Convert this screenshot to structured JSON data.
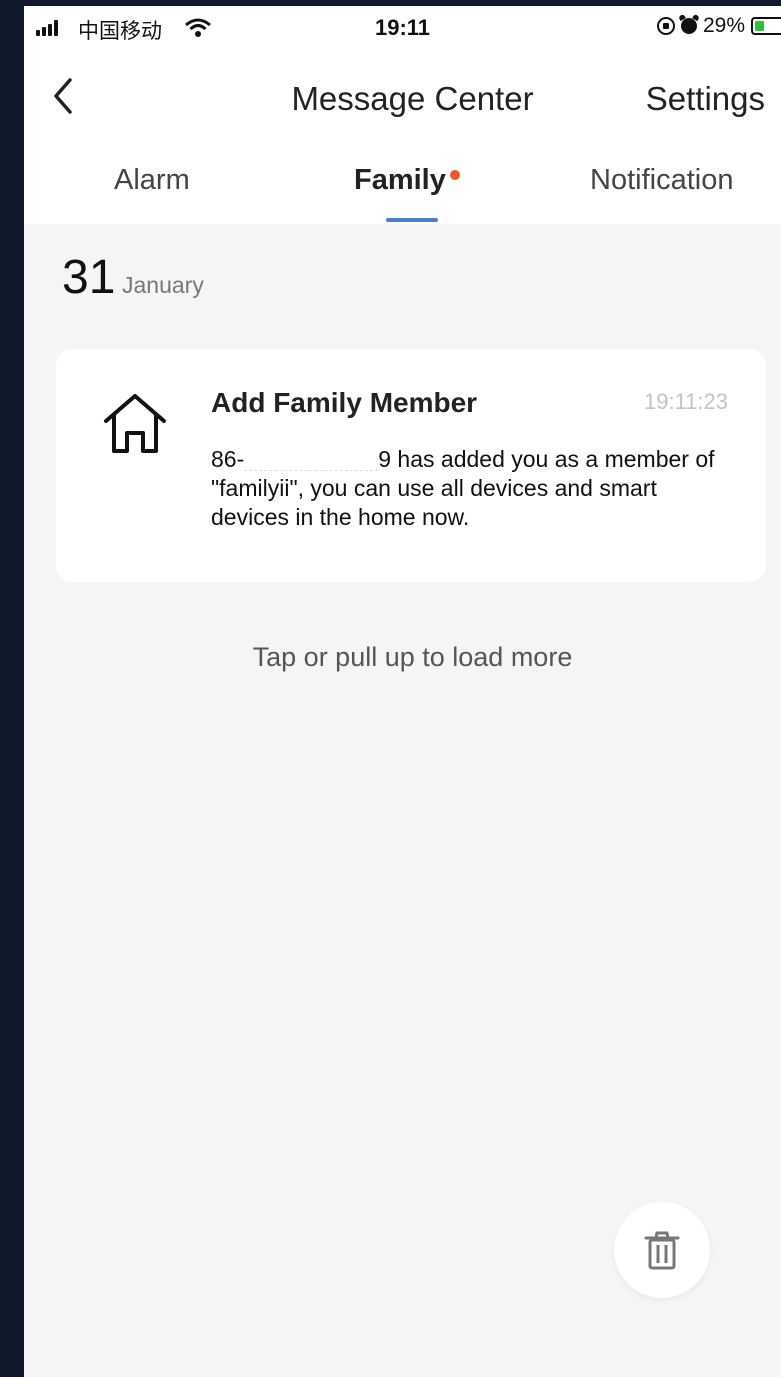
{
  "status_bar": {
    "carrier": "中国移动",
    "time": "19:11",
    "battery": "29%"
  },
  "nav": {
    "back_icon": "chevron-left-icon",
    "title": "Message Center",
    "settings_label": "Settings"
  },
  "tabs": [
    {
      "label": "Alarm",
      "active": false,
      "unread": false
    },
    {
      "label": "Family",
      "active": true,
      "unread": true
    },
    {
      "label": "Notification",
      "active": false,
      "unread": false
    }
  ],
  "date": {
    "day": "31",
    "month": "January"
  },
  "messages": [
    {
      "icon": "home-icon",
      "title": "Add Family Member",
      "time": "19:11:23",
      "body_prefix": "86-",
      "body_suffix": "9 has added you as a member of \"familyii\", you can use all devices and smart devices in the home now."
    }
  ],
  "load_more": "Tap or pull up to load more",
  "trash_icon": "trash-icon",
  "colors": {
    "accent": "#4a7fd4",
    "unread_dot": "#ee5a24",
    "background": "#f5f5f5",
    "frame": "#111a2c"
  }
}
